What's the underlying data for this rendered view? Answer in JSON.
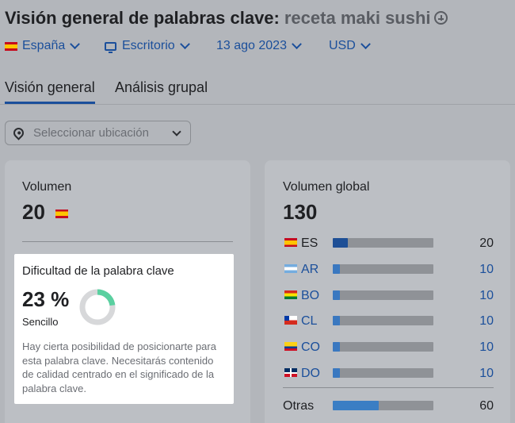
{
  "header": {
    "title": "Visión general de palabras clave:",
    "keyword": "receta maki sushi"
  },
  "filters": [
    {
      "label": "España",
      "icon": "spain-flag-icon"
    },
    {
      "label": "Escritorio",
      "icon": "monitor-icon"
    },
    {
      "label": "13 ago 2023",
      "icon": ""
    },
    {
      "label": "USD",
      "icon": ""
    }
  ],
  "tabs": [
    {
      "label": "Visión general",
      "active": true
    },
    {
      "label": "Análisis grupal",
      "active": false
    }
  ],
  "location": {
    "placeholder": "Seleccionar ubicación"
  },
  "volume": {
    "label": "Volumen",
    "value": "20"
  },
  "difficulty": {
    "title": "Dificultad de la palabra clave",
    "value": "23 %",
    "percent": 23,
    "level": "Sencillo",
    "description": "Hay cierta posibilidad de posicionarte para esta palabra clave. Necesitarás contenido de calidad centrado en el significado de la palabra clave.",
    "color": "#5ad0a0"
  },
  "global": {
    "label": "Volumen global",
    "value": "130",
    "rows": [
      {
        "code": "ES",
        "value": "20",
        "fill": 0.15,
        "flag": "es",
        "link": false
      },
      {
        "code": "AR",
        "value": "10",
        "fill": 0.07,
        "flag": "ar",
        "link": true
      },
      {
        "code": "BO",
        "value": "10",
        "fill": 0.07,
        "flag": "bo",
        "link": true
      },
      {
        "code": "CL",
        "value": "10",
        "fill": 0.07,
        "flag": "cl",
        "link": true
      },
      {
        "code": "CO",
        "value": "10",
        "fill": 0.07,
        "flag": "co",
        "link": true
      },
      {
        "code": "DO",
        "value": "10",
        "fill": 0.07,
        "flag": "do",
        "link": true
      }
    ],
    "other": {
      "label": "Otras",
      "value": "60",
      "fill": 0.46
    }
  },
  "colors": {
    "accent": "#1b4f9b",
    "bar_primary": "#1e4f96",
    "bar_secondary": "#3a78c0",
    "bar_other": "#3a7ec4"
  }
}
